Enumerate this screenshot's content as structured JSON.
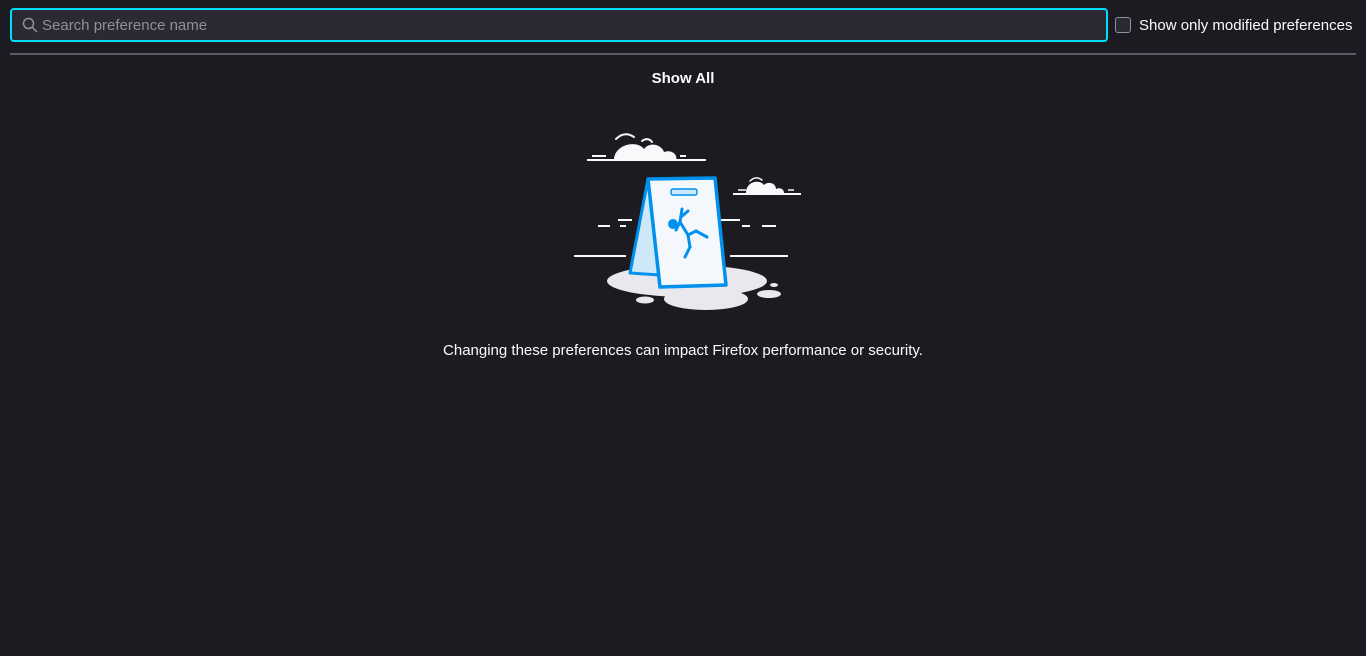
{
  "search": {
    "placeholder": "Search preference name",
    "value": ""
  },
  "filter": {
    "label": "Show only modified preferences",
    "checked": false
  },
  "show_all_label": "Show All",
  "warning": "Changing these preferences can impact Firefox performance or security.",
  "icons": {
    "search": "search-icon",
    "illustration": "caution-wet-floor-sign-illustration"
  },
  "colors": {
    "background": "#1c1b22",
    "input_background": "#2b2a33",
    "focus_ring": "#00ddff",
    "text": "#fbfbfe",
    "accent_blue": "#0090ed"
  }
}
